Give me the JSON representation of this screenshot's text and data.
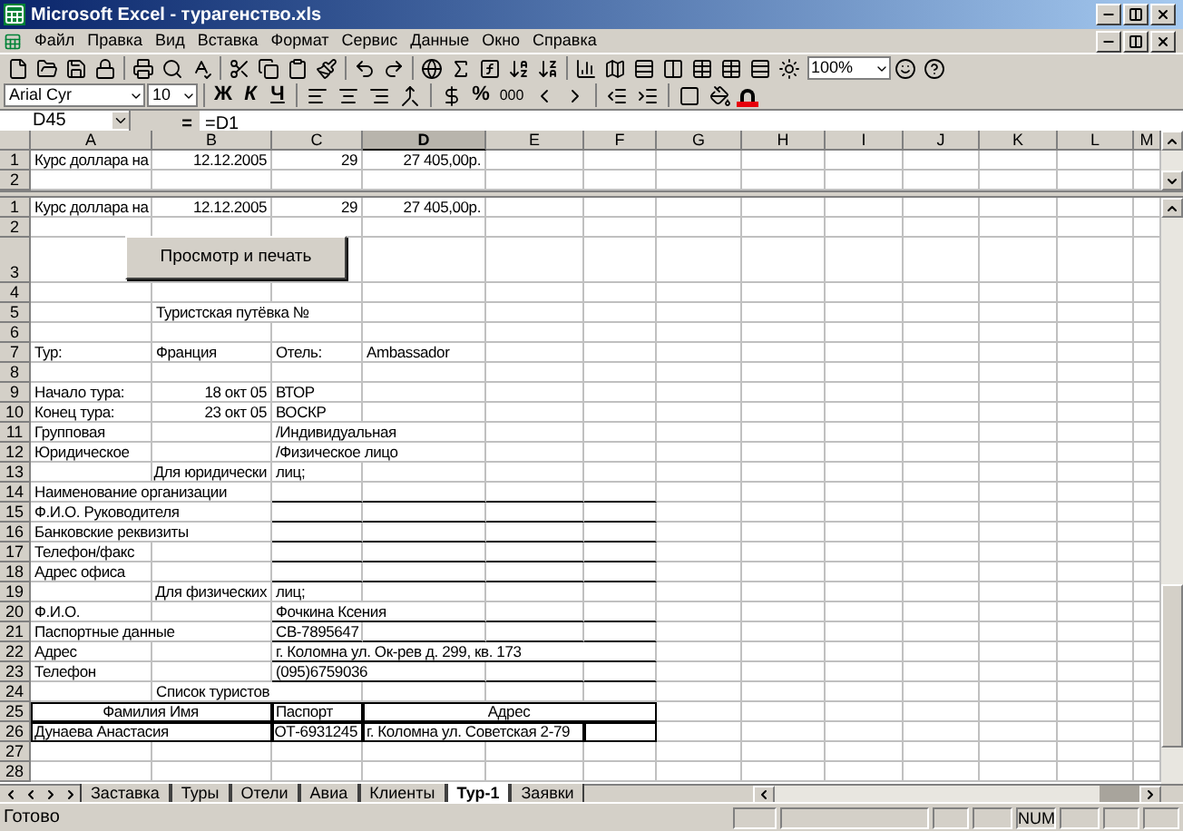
{
  "window": {
    "title": "Microsoft Excel - турагенство.xls"
  },
  "menu": [
    "Файл",
    "Правка",
    "Вид",
    "Вставка",
    "Формат",
    "Сервис",
    "Данные",
    "Окно",
    "Справка"
  ],
  "toolbar": {
    "zoom": "100%"
  },
  "format_bar": {
    "font": "Arial Cyr",
    "size": "10",
    "bold": "Ж",
    "italic": "К",
    "underline": "Ч",
    "percent": "%",
    "thousands": "000"
  },
  "formula_bar": {
    "cell": "D45",
    "equals": "=",
    "formula": "=D1"
  },
  "columns": [
    {
      "label": "A",
      "selected": false
    },
    {
      "label": "B",
      "selected": false
    },
    {
      "label": "C",
      "selected": false
    },
    {
      "label": "D",
      "selected": true
    },
    {
      "label": "E",
      "selected": false
    },
    {
      "label": "F",
      "selected": false
    },
    {
      "label": "G",
      "selected": false
    },
    {
      "label": "H",
      "selected": false
    },
    {
      "label": "I",
      "selected": false
    },
    {
      "label": "J",
      "selected": false
    },
    {
      "label": "K",
      "selected": false
    },
    {
      "label": "L",
      "selected": false
    },
    {
      "label": "M",
      "selected": false
    }
  ],
  "top_pane": [
    {
      "n": "1",
      "cells": {
        "A": {
          "text": "Курс доллара на"
        },
        "B": {
          "text": "12.12.2005",
          "kind": "number"
        },
        "C": {
          "text": "29",
          "kind": "number"
        },
        "D": {
          "text": "27 405,00р.",
          "kind": "number"
        }
      }
    },
    {
      "n": "2"
    }
  ],
  "bottom_pane": [
    {
      "n": "1",
      "cells": {
        "A": {
          "text": "Курс доллара на"
        },
        "B": {
          "text": "12.12.2005",
          "kind": "number"
        },
        "C": {
          "text": "29",
          "kind": "number"
        },
        "D": {
          "text": "27 405,00р.",
          "kind": "number"
        }
      }
    },
    {
      "n": "2"
    },
    {
      "n": "3",
      "kind": "tall"
    },
    {
      "n": "4"
    },
    {
      "n": "5",
      "cells": {
        "B": {
          "text": "Туристская путёвка №"
        }
      }
    },
    {
      "n": "6"
    },
    {
      "n": "7",
      "cells": {
        "A": {
          "text": "Тур:"
        },
        "B": {
          "text": "Франция"
        },
        "C": {
          "text": "Отель:"
        },
        "D": {
          "text": "Ambassador"
        }
      }
    },
    {
      "n": "8"
    },
    {
      "n": "9",
      "cells": {
        "A": {
          "text": "Начало тура:"
        },
        "B": {
          "text": "18 окт 05",
          "kind": "number"
        },
        "C": {
          "text": "ВТОР"
        }
      }
    },
    {
      "n": "10",
      "cells": {
        "A": {
          "text": "Конец тура:"
        },
        "B": {
          "text": "23 окт 05",
          "kind": "number"
        },
        "C": {
          "text": "ВОСКР"
        }
      }
    },
    {
      "n": "11",
      "cells": {
        "A": {
          "text": "Групповая"
        },
        "C": {
          "text": "/Индивидуальная"
        }
      }
    },
    {
      "n": "12",
      "cells": {
        "A": {
          "text": "Юридическое"
        },
        "C": {
          "text": "/Физическое лицо"
        }
      }
    },
    {
      "n": "13",
      "cells": {
        "B": {
          "text": "Для юридически",
          "kind": "number"
        },
        "C": {
          "text": "лиц;"
        }
      }
    },
    {
      "n": "14",
      "underline": true,
      "cells": {
        "A": {
          "text": "Наименование организации"
        }
      }
    },
    {
      "n": "15",
      "underline": true,
      "cells": {
        "A": {
          "text": "Ф.И.О. Руководителя"
        }
      }
    },
    {
      "n": "16",
      "underline": true,
      "cells": {
        "A": {
          "text": "Банковские реквизиты"
        }
      }
    },
    {
      "n": "17",
      "underline": true,
      "cells": {
        "A": {
          "text": "Телефон/факс"
        }
      }
    },
    {
      "n": "18",
      "underline": true,
      "cells": {
        "A": {
          "text": "Адрес офиса"
        }
      }
    },
    {
      "n": "19",
      "cells": {
        "B": {
          "text": "Для физических",
          "kind": "number"
        },
        "C": {
          "text": "лиц;"
        }
      }
    },
    {
      "n": "20",
      "underline": true,
      "cells": {
        "A": {
          "text": "Ф.И.О."
        },
        "C": {
          "text": "Фочкина Ксения"
        }
      }
    },
    {
      "n": "21",
      "underline": true,
      "cells": {
        "A": {
          "text": "Паспортные данные"
        },
        "C": {
          "text": "СВ-7895647"
        }
      }
    },
    {
      "n": "22",
      "underline": true,
      "cells": {
        "A": {
          "text": "Адрес"
        },
        "C": {
          "text": "г. Коломна ул. Ок-рев д. 299, кв. 173"
        }
      }
    },
    {
      "n": "23",
      "underline": true,
      "cells": {
        "A": {
          "text": "Телефон"
        },
        "C": {
          "text": "(095)6759036"
        }
      }
    },
    {
      "n": "24",
      "cells": {
        "B": {
          "text": "Список туристов"
        }
      }
    },
    {
      "n": "25",
      "cells": {
        "A:B": {
          "text": "Фамилия Имя",
          "kind": "heading",
          "boxed": true
        },
        "C": {
          "text": "Паспорт",
          "boxed": true
        },
        "D:F": {
          "text": "Адрес",
          "kind": "heading",
          "boxed": true
        }
      }
    },
    {
      "n": "26",
      "cells": {
        "A:B": {
          "text": "Дунаева Анастасия",
          "boxed": true
        },
        "C": {
          "text": "ОТ-6931245",
          "kind": "number",
          "boxed": true
        },
        "D:E": {
          "text": "г. Коломна ул. Советская 2-79",
          "boxed": true
        },
        "F": {
          "boxed": true
        }
      }
    },
    {
      "n": "27"
    },
    {
      "n": "28"
    }
  ],
  "sheet_button": {
    "label": "Просмотр и печать"
  },
  "sheet_tabs": [
    {
      "label": "Заставка",
      "selected": false
    },
    {
      "label": "Туры",
      "selected": false
    },
    {
      "label": "Отели",
      "selected": false
    },
    {
      "label": "Авиа",
      "selected": false
    },
    {
      "label": "Клиенты",
      "selected": false
    },
    {
      "label": "Тур-1",
      "selected": true
    },
    {
      "label": "Заявки",
      "selected": false
    }
  ],
  "status_bar": {
    "text": "Готово",
    "num": "NUM"
  }
}
